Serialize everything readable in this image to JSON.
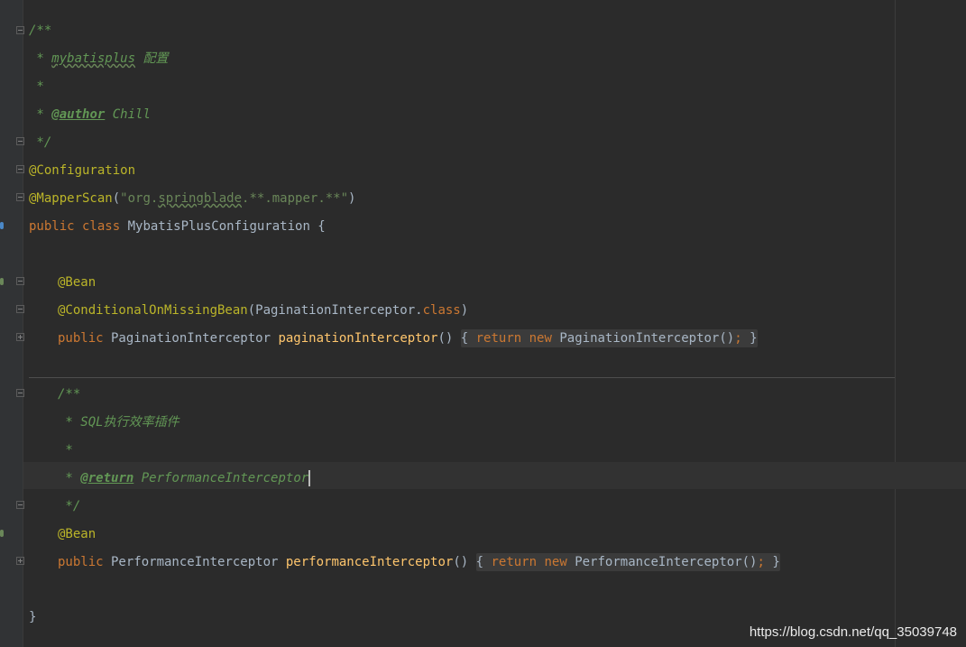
{
  "editor": {
    "lines": [
      {
        "t1": "/**"
      },
      {
        "t1": " * ",
        "t2": "mybatisplus",
        "t3": " 配置"
      },
      {
        "t1": " *"
      },
      {
        "t1": " * ",
        "t2": "@author",
        "t3": " Chill"
      },
      {
        "t1": " */"
      },
      {
        "t1": "@Configuration"
      },
      {
        "t1": "@MapperScan",
        "t2": "(",
        "t3": "\"org.",
        "t4": "springblade",
        "t5": ".**.mapper.**\"",
        "t6": ")"
      },
      {
        "t1": "public class",
        "t2": " MybatisPlusConfiguration {"
      },
      {
        "t1": "@Bean"
      },
      {
        "t1": "@ConditionalOnMissingBean",
        "t2": "(PaginationInterceptor.",
        "t3": "class",
        "t4": ")"
      },
      {
        "t1": "public",
        "t2": " PaginationInterceptor ",
        "t3": "paginationInterceptor",
        "t4": "() ",
        "t5": "{ ",
        "t6": "return new",
        "t7": " PaginationInterceptor()",
        "t8": ";",
        "t9": " }"
      },
      {
        "t1": "/**"
      },
      {
        "t1": " * SQL执行效率插件"
      },
      {
        "t1": " *"
      },
      {
        "t1": " * ",
        "t2": "@return",
        "t3": " PerformanceInterceptor"
      },
      {
        "t1": " */"
      },
      {
        "t1": "@Bean"
      },
      {
        "t1": "public",
        "t2": " PerformanceInterceptor ",
        "t3": "performanceInterceptor",
        "t4": "() ",
        "t5": "{ ",
        "t6": "return new",
        "t7": " PerformanceInterceptor()",
        "t8": ";",
        "t9": " }"
      },
      {
        "t1": "}"
      }
    ]
  },
  "watermark": "https://blog.csdn.net/qq_35039748",
  "colors": {
    "background": "#2b2b2b",
    "gutter": "#313335",
    "keyword": "#cc7832",
    "annotation": "#bbb529",
    "doc_comment": "#629755",
    "string": "#6a8759",
    "method": "#ffc66d",
    "text": "#a9b7c6"
  },
  "icons": [
    "fold-collapse-icon",
    "fold-expand-icon",
    "bean-gutter-icon",
    "implemented-arrow-icon"
  ]
}
